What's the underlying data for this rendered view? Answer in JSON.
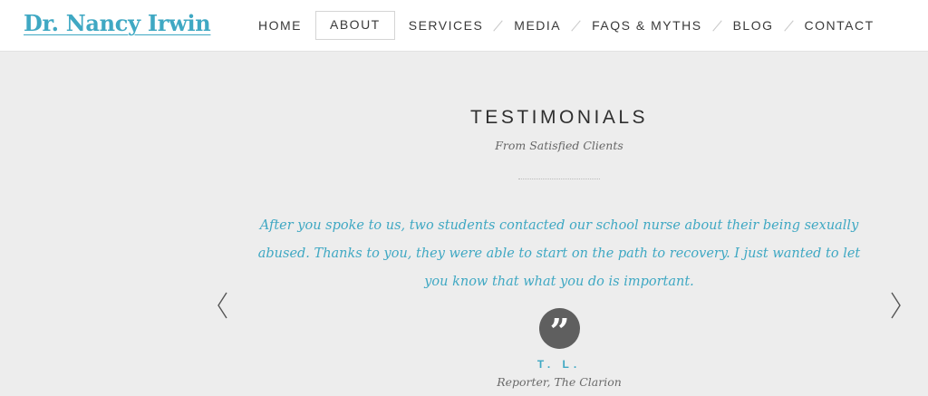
{
  "site": {
    "logo": "Dr. Nancy Irwin"
  },
  "nav": {
    "items": [
      {
        "label": "HOME"
      },
      {
        "label": "ABOUT"
      },
      {
        "label": "SERVICES"
      },
      {
        "label": "MEDIA"
      },
      {
        "label": "FAQS & MYTHS"
      },
      {
        "label": "BLOG"
      },
      {
        "label": "CONTACT"
      }
    ],
    "active": "ABOUT"
  },
  "testimonials": {
    "title": "TESTIMONIALS",
    "subtitle": "From Satisfied Clients",
    "quote": "After you spoke to us, two students contacted our school nurse about their being sexually abused. Thanks to you, they were able to start on the path to recovery. I just wanted to let you know that what you do is important.",
    "quote_glyph": "”",
    "author": "T. L.",
    "author_role": "Reporter, The Clarion"
  },
  "icons": {
    "prev": "chevron-left-icon",
    "next": "chevron-right-icon",
    "quote": "quote-icon"
  },
  "colors": {
    "accent": "#3fa8c3",
    "background": "#ededed",
    "badge": "#5f5f5f"
  }
}
